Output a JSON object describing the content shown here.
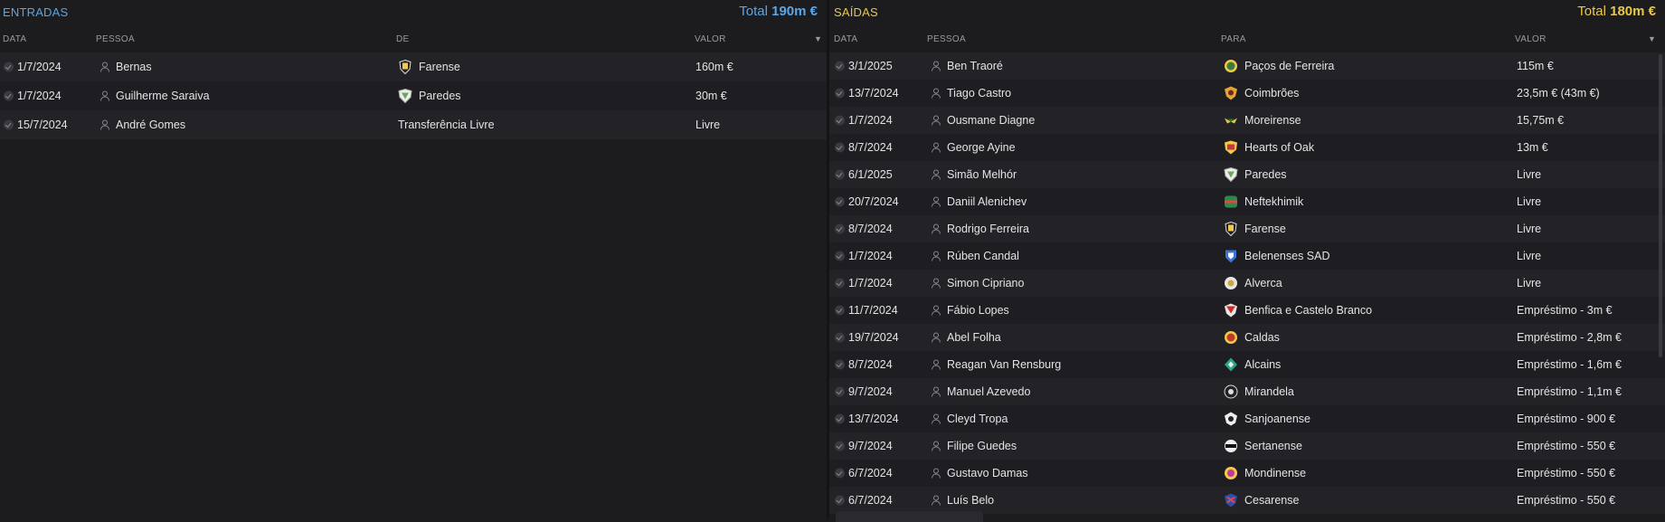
{
  "left": {
    "title": "ENTRADAS",
    "total_label": "Total",
    "total_value": "190m €",
    "columns": {
      "date": "DATA",
      "person": "PESSOA",
      "from": "DE",
      "value": "VALOR"
    },
    "rows": [
      {
        "date": "1/7/2024",
        "person": "Bernas",
        "club": "Farense",
        "value": "160m €",
        "crest": "farense"
      },
      {
        "date": "1/7/2024",
        "person": "Guilherme Saraiva",
        "club": "Paredes",
        "value": "30m €",
        "crest": "paredes"
      },
      {
        "date": "15/7/2024",
        "person": "André Gomes",
        "club": "Transferência Livre",
        "value": "Livre",
        "crest": ""
      }
    ]
  },
  "right": {
    "title": "SAÍDAS",
    "total_label": "Total",
    "total_value": "180m €",
    "columns": {
      "date": "DATA",
      "person": "PESSOA",
      "to": "PARA",
      "value": "VALOR"
    },
    "rows": [
      {
        "date": "3/1/2025",
        "person": "Ben Traoré",
        "club": "Paços de Ferreira",
        "value": "115m €",
        "crest": "pacos"
      },
      {
        "date": "13/7/2024",
        "person": "Tiago Castro",
        "club": "Coimbrões",
        "value": "23,5m € (43m €)",
        "crest": "coimbroes"
      },
      {
        "date": "1/7/2024",
        "person": "Ousmane Diagne",
        "club": "Moreirense",
        "value": "15,75m €",
        "crest": "moreirense"
      },
      {
        "date": "8/7/2024",
        "person": "George Ayine",
        "club": "Hearts of Oak",
        "value": "13m €",
        "crest": "hearts"
      },
      {
        "date": "6/1/2025",
        "person": "Simão Melhór",
        "club": "Paredes",
        "value": "Livre",
        "crest": "paredes"
      },
      {
        "date": "20/7/2024",
        "person": "Daniil Alenichev",
        "club": "Neftekhimik",
        "value": "Livre",
        "crest": "neftekhimik"
      },
      {
        "date": "8/7/2024",
        "person": "Rodrigo Ferreira",
        "club": "Farense",
        "value": "Livre",
        "crest": "farense"
      },
      {
        "date": "1/7/2024",
        "person": "Rúben Candal",
        "club": "Belenenses SAD",
        "value": "Livre",
        "crest": "belenenses"
      },
      {
        "date": "1/7/2024",
        "person": "Simon Cipriano",
        "club": "Alverca",
        "value": "Livre",
        "crest": "alverca"
      },
      {
        "date": "11/7/2024",
        "person": "Fábio Lopes",
        "club": "Benfica e Castelo Branco",
        "value": "Empréstimo - 3m €",
        "crest": "benfica"
      },
      {
        "date": "19/7/2024",
        "person": "Abel Folha",
        "club": "Caldas",
        "value": "Empréstimo - 2,8m €",
        "crest": "caldas"
      },
      {
        "date": "8/7/2024",
        "person": "Reagan Van Rensburg",
        "club": "Alcains",
        "value": "Empréstimo - 1,6m €",
        "crest": "alcains"
      },
      {
        "date": "9/7/2024",
        "person": "Manuel Azevedo",
        "club": "Mirandela",
        "value": "Empréstimo - 1,1m €",
        "crest": "mirandela"
      },
      {
        "date": "13/7/2024",
        "person": "Cleyd Tropa",
        "club": "Sanjoanense",
        "value": "Empréstimo - 900 €",
        "crest": "sanjoanense"
      },
      {
        "date": "9/7/2024",
        "person": "Filipe Guedes",
        "club": "Sertanense",
        "value": "Empréstimo - 550 €",
        "crest": "sertanense"
      },
      {
        "date": "6/7/2024",
        "person": "Gustavo Damas",
        "club": "Mondinense",
        "value": "Empréstimo - 550 €",
        "crest": "mondinense"
      },
      {
        "date": "6/7/2024",
        "person": "Luís Belo",
        "club": "Cesarense",
        "value": "Empréstimo - 550 €",
        "crest": "cesarense"
      }
    ]
  },
  "colors": {
    "incoming_accent": "#5aa6e6",
    "outgoing_accent": "#e8c84a",
    "background": "#1c1b1e"
  }
}
